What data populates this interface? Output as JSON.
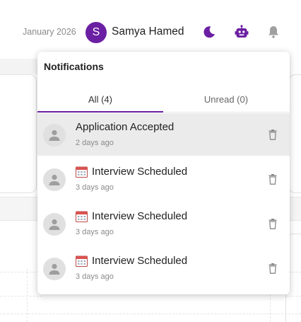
{
  "header": {
    "date": "January 2026",
    "avatar_letter": "S",
    "user_name": "Samya Hamed",
    "icons": [
      "moon-icon",
      "robot-icon",
      "bell-icon"
    ],
    "accent_color": "#6b1fa2"
  },
  "notifications": {
    "title": "Notifications",
    "tabs": [
      {
        "label": "All (4)",
        "active": true
      },
      {
        "label": "Unread (0)",
        "active": false
      }
    ],
    "items": [
      {
        "title": "Application Accepted",
        "time": "2 days ago",
        "icon": "person-icon",
        "has_calendar": false,
        "selected": true
      },
      {
        "title": "Interview Scheduled",
        "time": "3 days ago",
        "icon": "person-icon",
        "has_calendar": true,
        "selected": false
      },
      {
        "title": "Interview Scheduled",
        "time": "3 days ago",
        "icon": "person-icon",
        "has_calendar": true,
        "selected": false
      },
      {
        "title": "Interview Scheduled",
        "time": "3 days ago",
        "icon": "person-icon",
        "has_calendar": true,
        "selected": false
      }
    ]
  }
}
